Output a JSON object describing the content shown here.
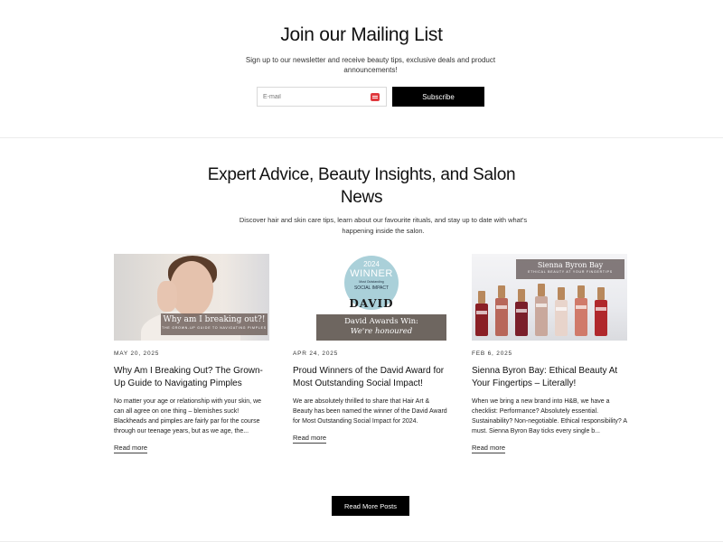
{
  "mailing": {
    "title": "Join our Mailing List",
    "subtitle": "Sign up to our newsletter and receive beauty tips, exclusive deals and product announcements!",
    "email_placeholder": "E-mail",
    "subscribe_label": "Subscribe"
  },
  "blog": {
    "title": "Expert Advice, Beauty Insights, and Salon News",
    "subtitle": "Discover hair and skin care tips, learn about our favourite rituals, and stay up to date with what's happening inside the salon.",
    "read_more_posts_label": "Read More Posts",
    "posts": [
      {
        "date": "MAY 20, 2025",
        "title": "Why Am I Breaking Out? The Grown-Up Guide to Navigating Pimples",
        "excerpt": "No matter your age or relationship with your skin, we can all agree on one thing – blemishes suck! Blackheads and pimples are fairly par for the course through our teenage years, but as we age, the...",
        "read_more": "Read more",
        "image_banner": "Why am I breaking out?!",
        "image_caption": "THE GROWN-UP GUIDE TO NAVIGATING PIMPLES"
      },
      {
        "date": "APR 24, 2025",
        "title": "Proud Winners of the David Award for Most Outstanding Social Impact!",
        "excerpt": "We are absolutely thrilled to share that Hair Art & Beauty has been named the winner of the David Award for Most Outstanding Social Impact for 2024.",
        "read_more": "Read more",
        "badge_year": "2024",
        "badge_winner": "WINNER",
        "badge_most": "Most Outstanding",
        "badge_category": "SOCIAL IMPACT",
        "badge_brand": "DAVID",
        "image_banner": "David Awards Win:",
        "image_caption": "We're honoured"
      },
      {
        "date": "FEB 6, 2025",
        "title": "Sienna Byron Bay: Ethical Beauty At Your Fingertips – Literally!",
        "excerpt": "When we bring a new brand into H&B, we have a checklist: Performance? Absolutely essential. Sustainability? Non-negotiable. Ethical responsibility? A must. Sienna Byron Bay ticks every single b...",
        "read_more": "Read more",
        "image_banner": "Sienna Byron Bay",
        "image_caption": "ETHICAL BEAUTY AT YOUR FINGERTIPS"
      }
    ]
  },
  "colors": {
    "button_bg": "#000000",
    "email_icon": "#e0393e",
    "badge_blue": "#aad0d9"
  }
}
